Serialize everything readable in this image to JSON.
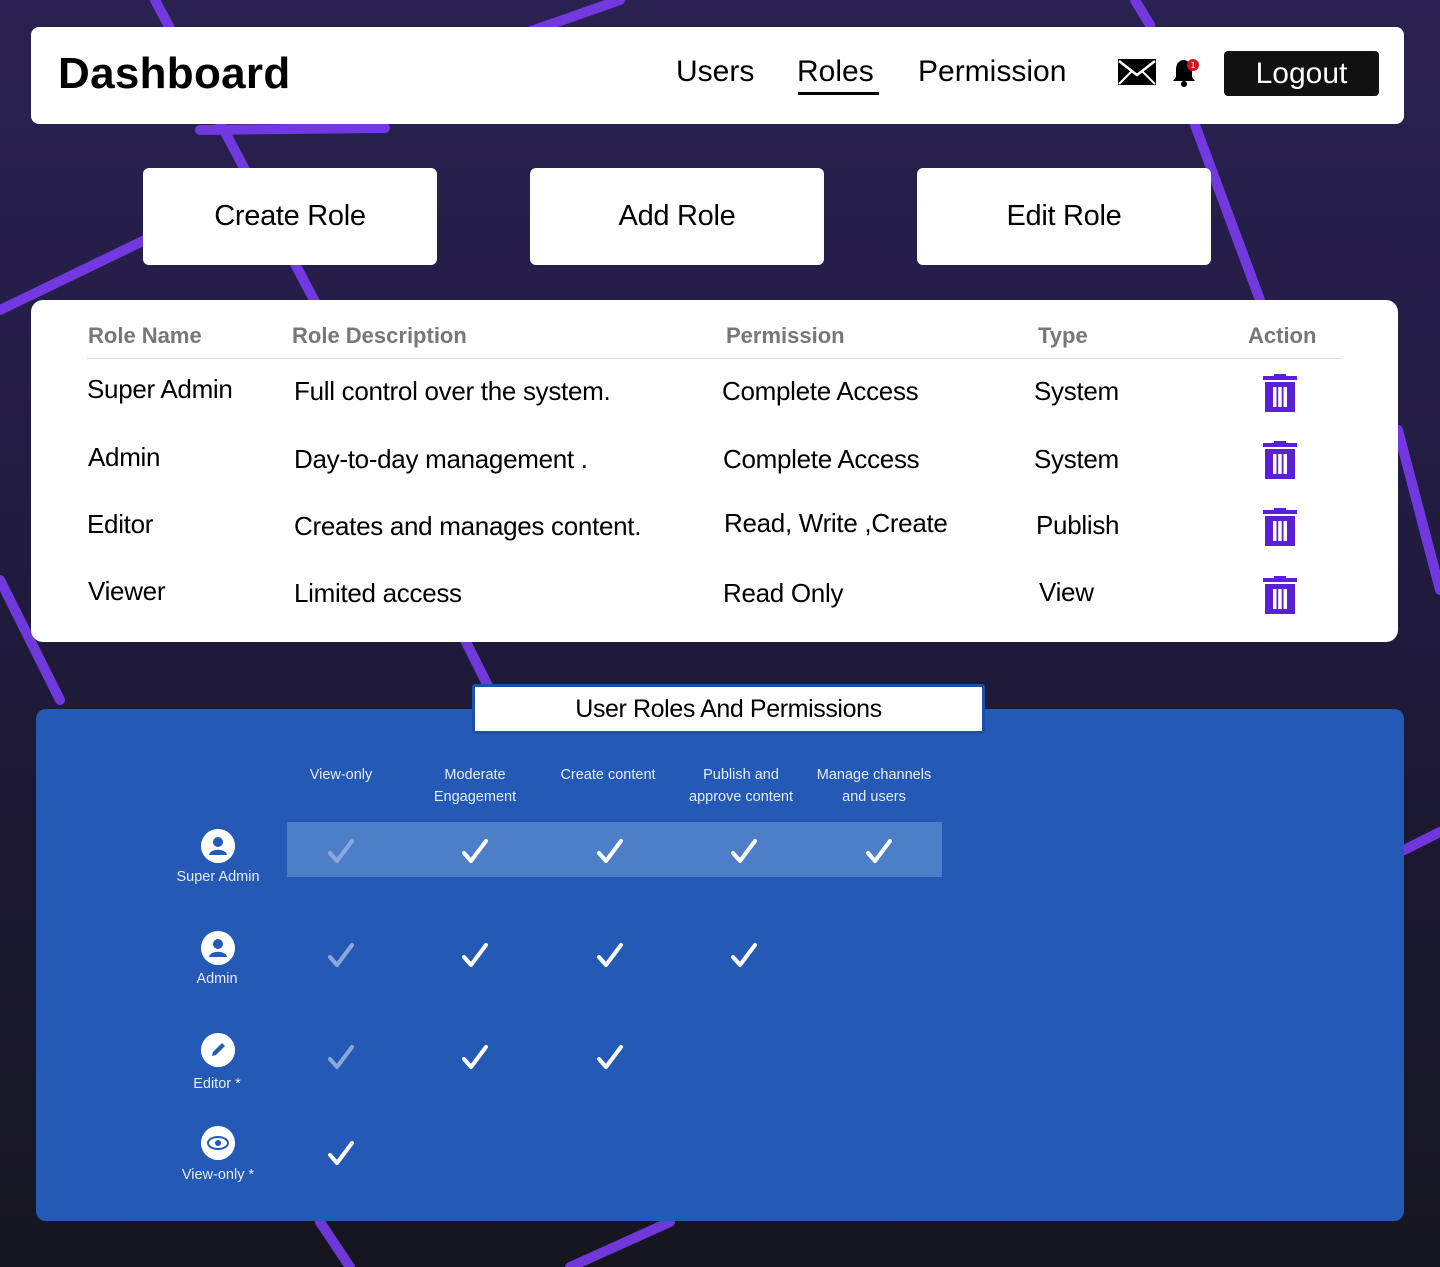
{
  "header": {
    "title": "Dashboard",
    "nav": [
      {
        "label": "Users",
        "active": false
      },
      {
        "label": "Roles",
        "active": true
      },
      {
        "label": "Permission",
        "active": false
      }
    ],
    "notification_count": "1",
    "logout_label": "Logout"
  },
  "actions": {
    "create": "Create Role",
    "add": "Add Role",
    "edit": "Edit Role"
  },
  "roles_table": {
    "headers": [
      "Role Name",
      "Role Description",
      "Permission",
      "Type",
      "Action"
    ],
    "rows": [
      {
        "name": "Super Admin",
        "description": "Full control over the system.",
        "permission": "Complete Access",
        "type": "System"
      },
      {
        "name": "Admin",
        "description": "Day-to-day management .",
        "permission": "Complete Access",
        "type": "System"
      },
      {
        "name": "Editor",
        "description": "Creates and manages content.",
        "permission": "Read, Write ,Create",
        "type": "Publish"
      },
      {
        "name": "Viewer",
        "description": "Limited access",
        "permission": "Read Only",
        "type": "View"
      }
    ]
  },
  "matrix": {
    "title": "User Roles And Permissions",
    "columns": [
      {
        "line1": "",
        "line2": "View-only"
      },
      {
        "line1": "Moderate",
        "line2": "Engagement"
      },
      {
        "line1": "",
        "line2": "Create content"
      },
      {
        "line1": "Publish and",
        "line2": "approve content"
      },
      {
        "line1": "Manage channels",
        "line2": "and users"
      }
    ],
    "roles": [
      {
        "label": "Super Admin",
        "icon": "user-icon",
        "checks": [
          true,
          true,
          true,
          true,
          true
        ]
      },
      {
        "label": "Admin",
        "icon": "user-icon",
        "checks": [
          true,
          true,
          true,
          true,
          false
        ]
      },
      {
        "label": "Editor *",
        "icon": "pencil-icon",
        "checks": [
          true,
          true,
          true,
          false,
          false
        ]
      },
      {
        "label": "View-only *",
        "icon": "eye-icon",
        "checks": [
          true,
          false,
          false,
          false,
          false
        ]
      }
    ]
  },
  "colors": {
    "trash": "#5b1fd6",
    "panel": "#2459b5",
    "highlight_row": "#4d7ec8",
    "accent_lines": "#7b3cf0"
  }
}
